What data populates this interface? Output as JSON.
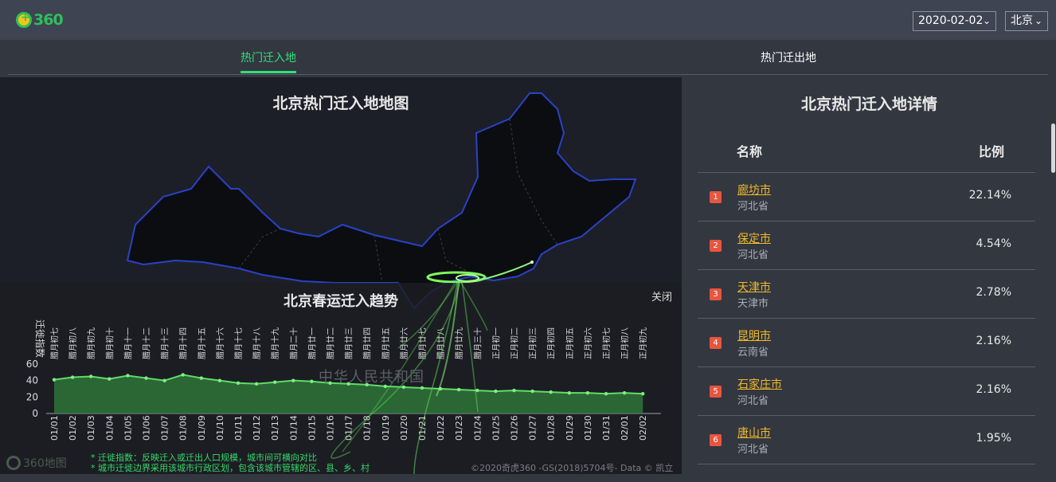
{
  "header": {
    "logo_text": "360",
    "date_select": "2020-02-02",
    "city_select": "北京"
  },
  "tabs": {
    "in_label": "热门迁入地",
    "out_label": "热门迁出地"
  },
  "map": {
    "title": "北京热门迁入地地图",
    "country_label": "中华人民共和国",
    "copyright": "©2020奇虎360 -GS(2018)5704号- Data © 凯立德"
  },
  "trend": {
    "title": "北京春运迁入趋势",
    "close_label": "关闭"
  },
  "footer": {
    "logo_text": "360地图",
    "note1": "* 迁徙指数：反映迁入或迁出人口规模，城市间可横向对比",
    "note2": "* 城市迁徙边界采用该城市行政区划，包含该城市管辖的区、县、乡、村"
  },
  "detail": {
    "title": "北京热门迁入地详情",
    "col_name": "名称",
    "col_ratio": "比例",
    "rows": [
      {
        "rank": "1",
        "city": "廊坊市",
        "province": "河北省",
        "ratio": "22.14%"
      },
      {
        "rank": "2",
        "city": "保定市",
        "province": "河北省",
        "ratio": "4.54%"
      },
      {
        "rank": "3",
        "city": "天津市",
        "province": "天津市",
        "ratio": "2.78%"
      },
      {
        "rank": "4",
        "city": "昆明市",
        "province": "云南省",
        "ratio": "2.16%"
      },
      {
        "rank": "5",
        "city": "石家庄市",
        "province": "河北省",
        "ratio": "2.16%"
      },
      {
        "rank": "6",
        "city": "唐山市",
        "province": "河北省",
        "ratio": "1.95%"
      }
    ]
  },
  "colors": {
    "accent": "#2fe07a",
    "rank_badge": "#e8553f",
    "city_link": "#f0b92a",
    "line": "#3fbf4f"
  },
  "chart_data": {
    "type": "area",
    "title": "北京春运迁入趋势",
    "ylabel": "迁徙指数",
    "ylim": [
      0,
      60
    ],
    "yticks": [
      0,
      20,
      40,
      60
    ],
    "categories": [
      "01/01",
      "01/02",
      "01/03",
      "01/04",
      "01/05",
      "01/06",
      "01/07",
      "01/08",
      "01/09",
      "01/10",
      "01/11",
      "01/12",
      "01/13",
      "01/14",
      "01/15",
      "01/16",
      "01/17",
      "01/18",
      "01/19",
      "01/20",
      "01/21",
      "01/22",
      "01/23",
      "01/24",
      "01/25",
      "01/26",
      "01/27",
      "01/28",
      "01/29",
      "01/30",
      "01/31",
      "02/01",
      "02/02"
    ],
    "lunar_labels": [
      "腊月初七",
      "腊月初八",
      "腊月初九",
      "腊月初十",
      "腊月十一",
      "腊月十二",
      "腊月十三",
      "腊月十四",
      "腊月十五",
      "腊月十六",
      "腊月十七",
      "腊月十八",
      "腊月十九",
      "腊月二十",
      "腊月廿一",
      "腊月廿二",
      "腊月廿三",
      "腊月廿四",
      "腊月廿五",
      "腊月廿六",
      "腊月廿七",
      "腊月廿八",
      "腊月廿九",
      "腊月三十",
      "正月初一",
      "正月初二",
      "正月初三",
      "正月初四",
      "正月初五",
      "正月初六",
      "正月初七",
      "正月初八",
      "正月初九"
    ],
    "series": [
      {
        "values": [
          41,
          44,
          45,
          42,
          46,
          43,
          40,
          47,
          43,
          40,
          37,
          36,
          38,
          40,
          39,
          37,
          36,
          35,
          33,
          32,
          31,
          30,
          29,
          28,
          27,
          28,
          27,
          26,
          25,
          25,
          24,
          25,
          24
        ]
      }
    ]
  }
}
